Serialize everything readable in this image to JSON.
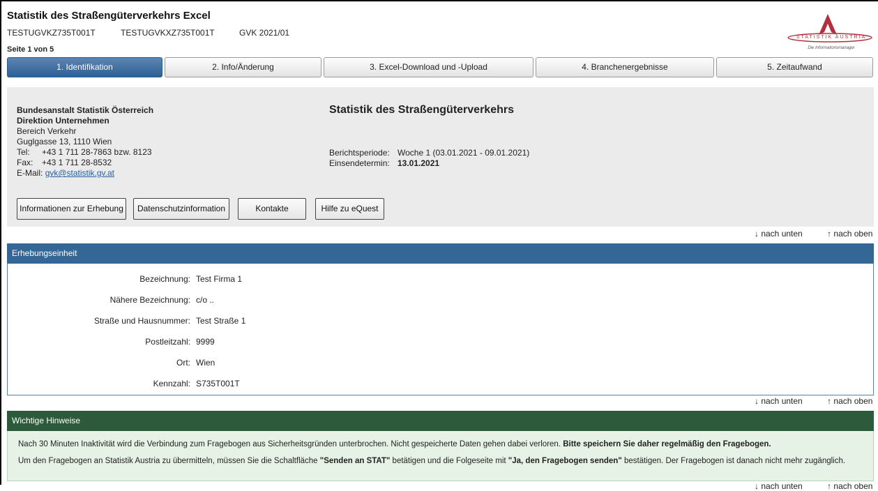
{
  "app": {
    "title": "Statistik des Straßengüterverkehrs Excel",
    "id1": "TESTUGVKZ735T001T",
    "id2": "TESTUGVKXZ735T001T",
    "survey_code": "GVK 2021/01",
    "page_indicator": "Seite 1 von 5",
    "logo_name": "STATISTIK AUSTRIA",
    "logo_tagline": "Die Informationsmanager",
    "brand_color": "#b03040"
  },
  "tabs": [
    {
      "label": "1. Identifikation",
      "active": true
    },
    {
      "label": "2. Info/Änderung",
      "active": false
    },
    {
      "label": "3. Excel-Download und -Upload",
      "active": false
    },
    {
      "label": "4. Branchenergebnisse",
      "active": false
    },
    {
      "label": "5. Zeitaufwand",
      "active": false
    }
  ],
  "org": {
    "name": "Bundesanstalt Statistik Österreich",
    "division": "Direktion Unternehmen",
    "department": "Bereich Verkehr",
    "address": "Guglgasse 13, 1110 Wien",
    "tel_label": "Tel:",
    "tel": "+43 1 711 28-7863 bzw. 8123",
    "fax_label": "Fax:",
    "fax": "+43 1 711 28-8532",
    "email_label": "E-Mail:",
    "email": "gvk@statistik.gv.at"
  },
  "survey": {
    "title": "Statistik des Straßengüterverkehrs",
    "period_label": "Berichtsperiode:",
    "period_value": "Woche 1 (03.01.2021 - 09.01.2021)",
    "deadline_label": "Einsendetermin:",
    "deadline_value": "13.01.2021"
  },
  "buttons": {
    "info": "Informationen zur Erhebung",
    "privacy": "Datenschutzinformation",
    "contacts": "Kontakte",
    "help": "Hilfe zu eQuest"
  },
  "nav": {
    "down": "↓ nach unten",
    "up": "↑ nach oben"
  },
  "unit": {
    "header": "Erhebungseinheit",
    "fields": [
      {
        "label": "Bezeichnung:",
        "value": "Test Firma 1"
      },
      {
        "label": "Nähere Bezeichnung:",
        "value": "c/o .."
      },
      {
        "label": "Straße und Hausnummer:",
        "value": "Test Straße 1"
      },
      {
        "label": "Postleitzahl:",
        "value": "9999"
      },
      {
        "label": "Ort:",
        "value": "Wien"
      },
      {
        "label": "Kennzahl:",
        "value": "S735T001T"
      }
    ]
  },
  "hints": {
    "header": "Wichtige Hinweise",
    "line1_text": "Nach 30 Minuten Inaktivität wird die Verbindung zum Fragebogen aus Sicherheitsgründen unterbrochen. Nicht gespeicherte Daten gehen dabei verloren.",
    "line1_bold": "Bitte speichern Sie daher regelmäßig den Fragebogen.",
    "line2_a": "Um den Fragebogen an Statistik Austria zu übermitteln, müssen Sie die Schaltfläche",
    "line2_b": "\"Senden an STAT\"",
    "line2_c": "betätigen und die Folgeseite mit",
    "line2_d": "\"Ja, den Fragebogen senden\"",
    "line2_e": "bestätigen. Der Fragebogen ist danach nicht mehr zugänglich."
  }
}
